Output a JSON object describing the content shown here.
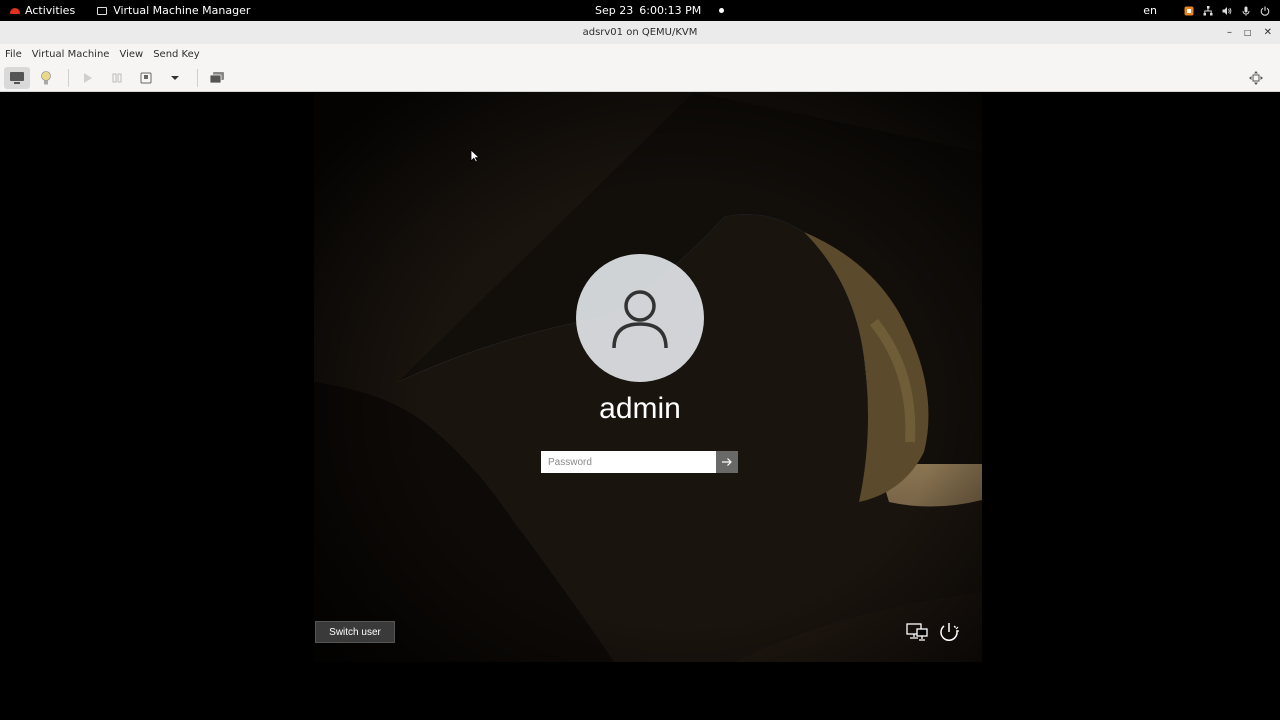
{
  "topbar": {
    "activities": "Activities",
    "app_name": "Virtual Machine Manager",
    "date": "Sep 23",
    "time": "6:00:13 PM",
    "lang": "en"
  },
  "window": {
    "title": "adsrv01 on QEMU/KVM",
    "menu": [
      "File",
      "Virtual Machine",
      "View",
      "Send Key"
    ]
  },
  "login": {
    "username": "admin",
    "password_placeholder": "Password",
    "switch_user": "Switch user"
  },
  "colors": {
    "accent_red": "#e0301e",
    "titlebar": "#ebebeb",
    "toolbar": "#f6f5f4"
  }
}
